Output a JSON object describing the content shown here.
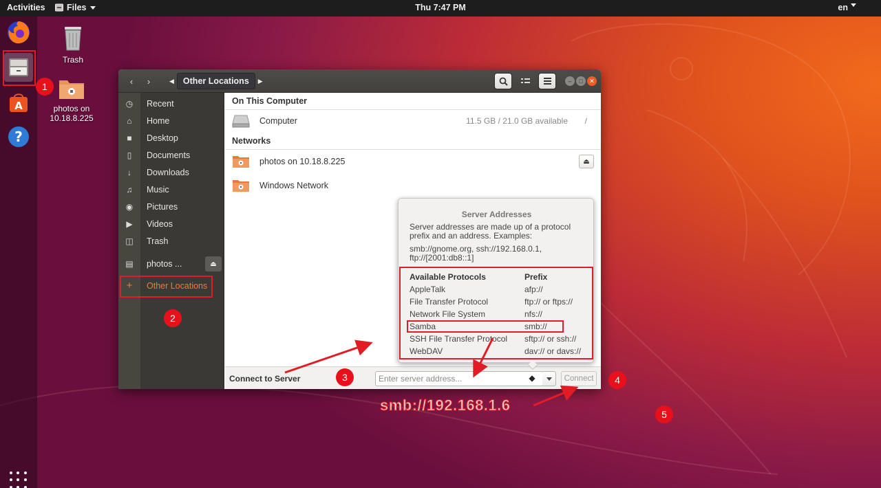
{
  "topbar": {
    "activities": "Activities",
    "app_menu": "Files",
    "clock": "Thu  7:47 PM",
    "language": "en"
  },
  "desktop": {
    "trash_label": "Trash",
    "network_share_label_line1": "photos on",
    "network_share_label_line2": "10.18.8.225"
  },
  "window": {
    "path_current": "Other Locations"
  },
  "sidebar": {
    "items": [
      {
        "label": "Recent",
        "icon": "clock-icon"
      },
      {
        "label": "Home",
        "icon": "home-icon"
      },
      {
        "label": "Desktop",
        "icon": "folder-icon"
      },
      {
        "label": "Documents",
        "icon": "document-icon"
      },
      {
        "label": "Downloads",
        "icon": "download-icon"
      },
      {
        "label": "Music",
        "icon": "music-icon"
      },
      {
        "label": "Pictures",
        "icon": "camera-icon"
      },
      {
        "label": "Videos",
        "icon": "video-icon"
      },
      {
        "label": "Trash",
        "icon": "trash-icon"
      }
    ],
    "mount_label": "photos ...",
    "other_locations": "Other Locations"
  },
  "main": {
    "on_this_computer": "On This Computer",
    "computer_name": "Computer",
    "computer_space": "11.5 GB / 21.0 GB available",
    "computer_mount": "/",
    "networks": "Networks",
    "network_share": "photos on 10.18.8.225",
    "windows_network": "Windows Network"
  },
  "connect_bar": {
    "label": "Connect to Server",
    "placeholder": "Enter server address...",
    "connect_button": "Connect"
  },
  "popover": {
    "title": "Server Addresses",
    "description": "Server addresses are made up of a protocol prefix and an address. Examples:",
    "examples": "smb://gnome.org, ssh://192.168.0.1, ftp://[2001:db8::1]",
    "col_protocol": "Available Protocols",
    "col_prefix": "Prefix",
    "protocols": [
      {
        "name": "AppleTalk",
        "prefix": "afp://"
      },
      {
        "name": "File Transfer Protocol",
        "prefix": "ftp:// or ftps://"
      },
      {
        "name": "Network File System",
        "prefix": "nfs://"
      },
      {
        "name": "Samba",
        "prefix": "smb://"
      },
      {
        "name": "SSH File Transfer Protocol",
        "prefix": "sftp:// or ssh://"
      },
      {
        "name": "WebDAV",
        "prefix": "dav:// or davs://"
      }
    ]
  },
  "annotations": {
    "badges": [
      "1",
      "2",
      "3",
      "4",
      "5"
    ],
    "server_address_hint": "smb://192.168.1.6",
    "color": "#e21c24"
  }
}
